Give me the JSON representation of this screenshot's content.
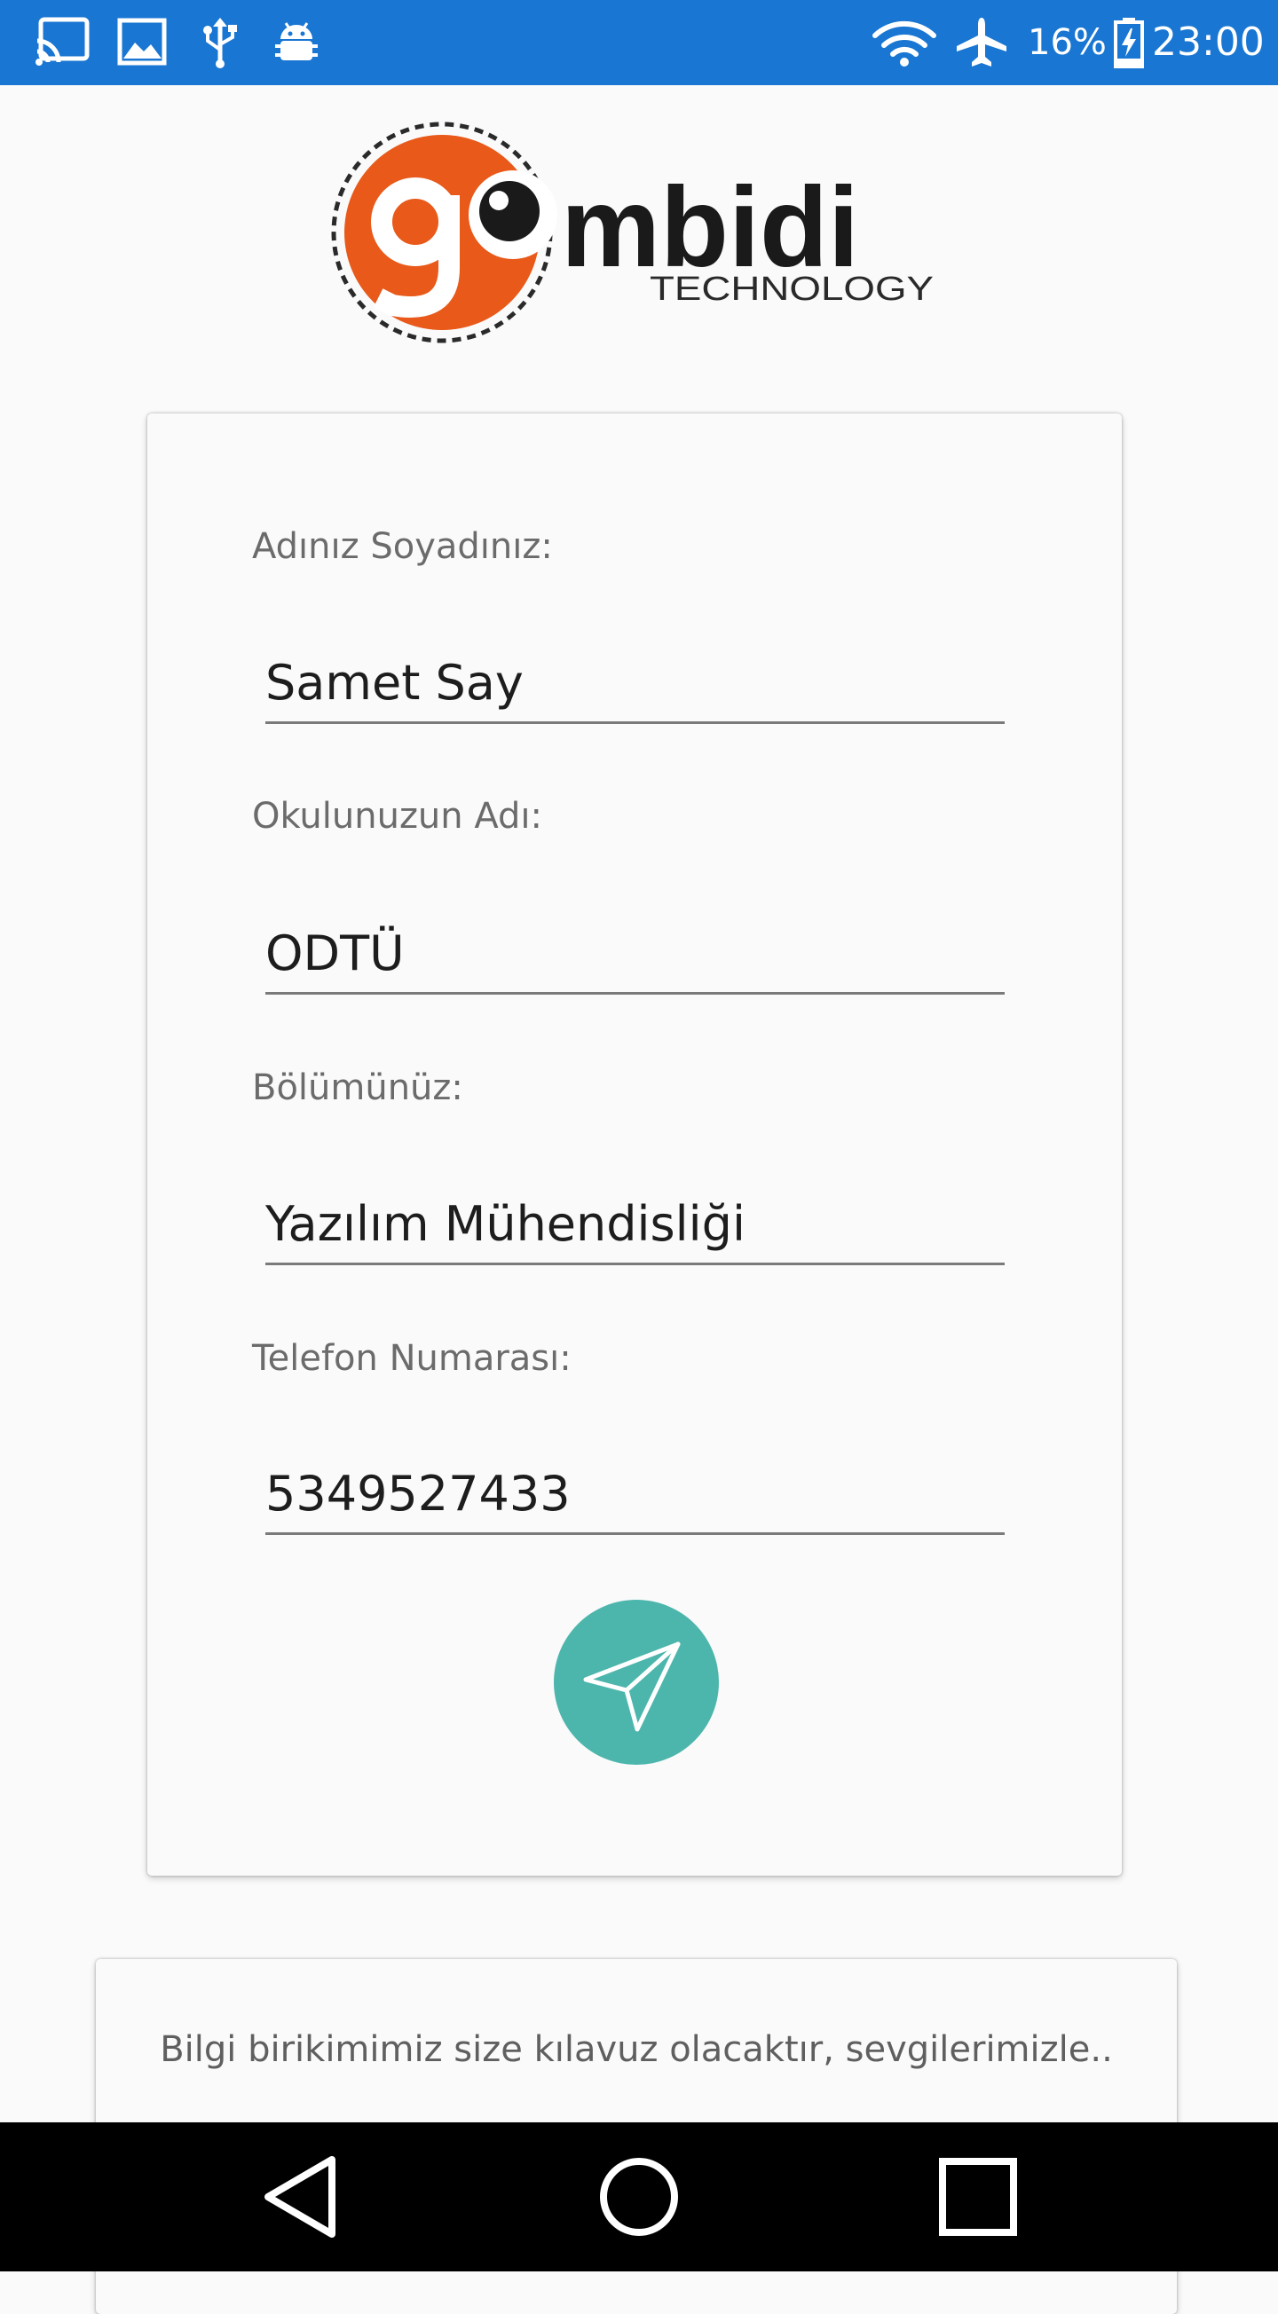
{
  "colors": {
    "status_bar": "#1976d2",
    "accent_teal": "#4db6ac",
    "logo_orange": "#e8591a",
    "background": "#fafafa",
    "nav_bar": "#000000"
  },
  "status_bar": {
    "left_icons": [
      "cast-icon",
      "image-icon",
      "usb-icon",
      "android-debug-icon"
    ],
    "right_icons": [
      "wifi-icon",
      "airplane-mode-icon",
      "battery-charging-icon"
    ],
    "battery_percent": "16%",
    "time": "23:00"
  },
  "logo": {
    "brand": "gombidi",
    "subtitle": "TECHNOLOGY"
  },
  "form": {
    "fields": [
      {
        "label": "Adınız Soyadınız:",
        "value": "Samet Say"
      },
      {
        "label": "Okulunuzun Adı:",
        "value": "ODTÜ"
      },
      {
        "label": "Bölümünüz:",
        "value": "Yazılım Mühendisliği"
      },
      {
        "label": "Telefon Numarası:",
        "value": "5349527433"
      }
    ],
    "submit_icon": "send-icon"
  },
  "footer": {
    "text": "Bilgi birikimimiz size kılavuz olacaktır, sevgilerimizle.."
  },
  "nav_bar": {
    "buttons": [
      "back-icon",
      "home-icon",
      "recents-icon"
    ]
  }
}
